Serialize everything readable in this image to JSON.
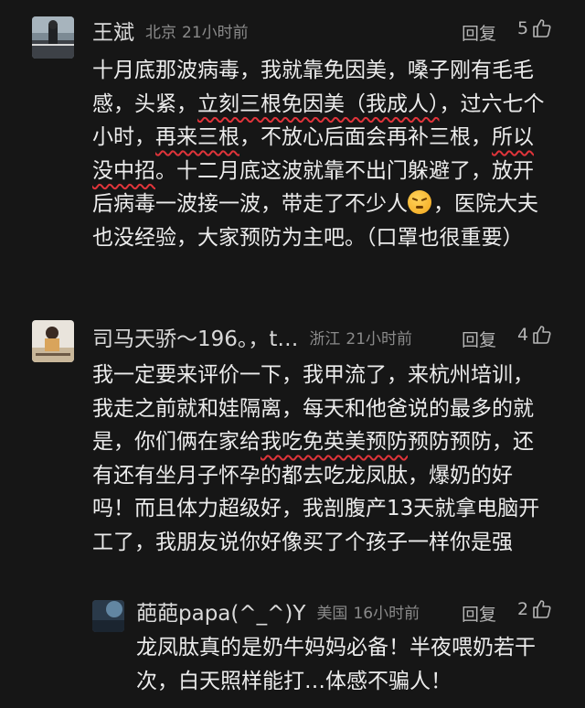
{
  "comments": [
    {
      "name": "王斌",
      "location": "北京",
      "time": "21小时前",
      "reply_label": "回复",
      "likes": "5",
      "text": {
        "a": "十月底那波病毒，我就靠免因美，嗓子刚有毛毛感，头紧，",
        "u1": "立刻三根免因美（我成人）",
        "b": "，过六七个小时，",
        "u2": "再来三根",
        "c": "，不放心后面会再补三根，",
        "u3": "所以没中招",
        "d": "。十二月底这波就靠不出门躲避了，放开后病毒一波接一波，带走了不少人",
        "e": "，医院大夫也没经验，大家预防为主吧。（口罩也很重要）",
        "emoji": "tired-face-emoji"
      }
    },
    {
      "name": "司马天骄～196。，t…",
      "location": "浙江",
      "time": "21小时前",
      "reply_label": "回复",
      "likes": "4",
      "text": {
        "a": "我一定要来评价一下，我甲流了，来杭州培训，我走之前就和娃隔离，每天和他爸说的最多的就是，你们俩在家给",
        "u1": "我吃免英美预防",
        "b": "预防预防，还有还有坐月子怀孕的都去吃龙凤肽，爆奶的好吗！而且体力超级好，我剖腹产13天就拿电脑开工了，我朋友说你好像买了个孩子一样你是强"
      }
    },
    {
      "name": "葩葩papa(^_^)Y",
      "location": "美国",
      "time": "16小时前",
      "reply_label": "回复",
      "likes": "2",
      "text": "龙凤肽真的是奶牛妈妈必备！半夜喂奶若干次，白天照样能打…体感不骗人！"
    }
  ],
  "colors": {
    "background": "#161616",
    "underline": "#e0343a",
    "meta_text": "#8a8a8a"
  }
}
